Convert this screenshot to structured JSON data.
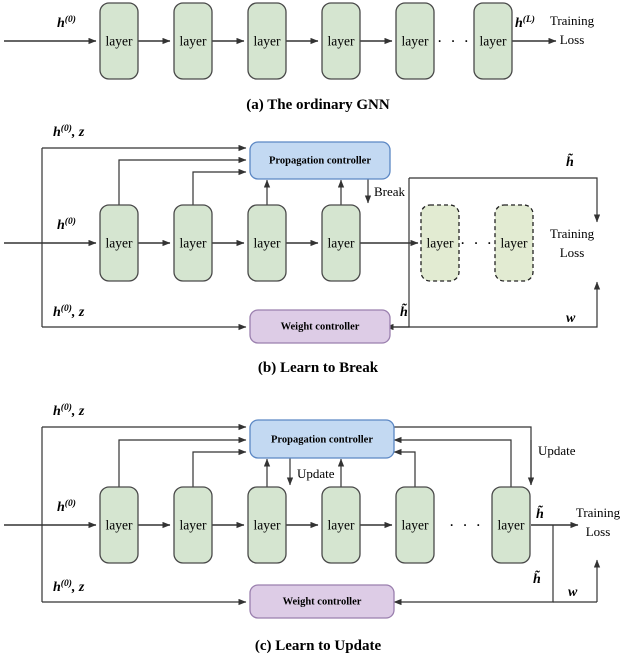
{
  "figure": {
    "title": "GNN propagation control architectures",
    "colors": {
      "layer_fill": "#d5e5d0",
      "layer_ghost_fill": "#e2ebd2",
      "propagation_controller_fill": "#c3d9f2",
      "weight_controller_fill": "#ddcce6",
      "stroke": "#333333"
    }
  },
  "panels": [
    {
      "id": "a",
      "caption": "(a) The ordinary GNN",
      "layers": [
        "layer",
        "layer",
        "layer",
        "layer",
        "layer",
        "layer"
      ],
      "ellipsis": "· · ·",
      "input_label": "h",
      "input_sup": "(0)",
      "output_label": "h",
      "output_sup": "(L)",
      "loss_line1": "Training",
      "loss_line2": "Loss"
    },
    {
      "id": "b",
      "caption": "(b) Learn to Break",
      "layers": [
        "layer",
        "layer",
        "layer",
        "layer"
      ],
      "ghost_layers": [
        "layer",
        "layer"
      ],
      "ellipsis": "· · ·",
      "propagation_controller": "Propagation controller",
      "weight_controller": "Weight controller",
      "break_label": "Break",
      "top_feedback": "h⁽⁰⁾, z",
      "top_feedback_base": "h",
      "top_feedback_sup": "(0)",
      "top_feedback_z": "z",
      "input_label": "h",
      "input_sup": "(0)",
      "bottom_feedback_base": "h",
      "bottom_feedback_sup": "(0)",
      "bottom_feedback_z": "z",
      "h_tilde_top": "h̃",
      "h_tilde_bottom": "h̃",
      "w_label": "w",
      "loss_line1": "Training",
      "loss_line2": "Loss"
    },
    {
      "id": "c",
      "caption": "(c) Learn to Update",
      "layers": [
        "layer",
        "layer",
        "layer",
        "layer",
        "layer",
        "layer"
      ],
      "ellipsis": "· · ·",
      "propagation_controller": "Propagation controller",
      "weight_controller": "Weight controller",
      "update_label_inner": "Update",
      "update_label_outer": "Update",
      "top_feedback_base": "h",
      "top_feedback_sup": "(0)",
      "top_feedback_z": "z",
      "input_label": "h",
      "input_sup": "(0)",
      "bottom_feedback_base": "h",
      "bottom_feedback_sup": "(0)",
      "bottom_feedback_z": "z",
      "h_tilde_top": "h̃",
      "h_tilde_bottom": "h̃",
      "w_label": "w",
      "loss_line1": "Training",
      "loss_line2": "Loss"
    }
  ]
}
